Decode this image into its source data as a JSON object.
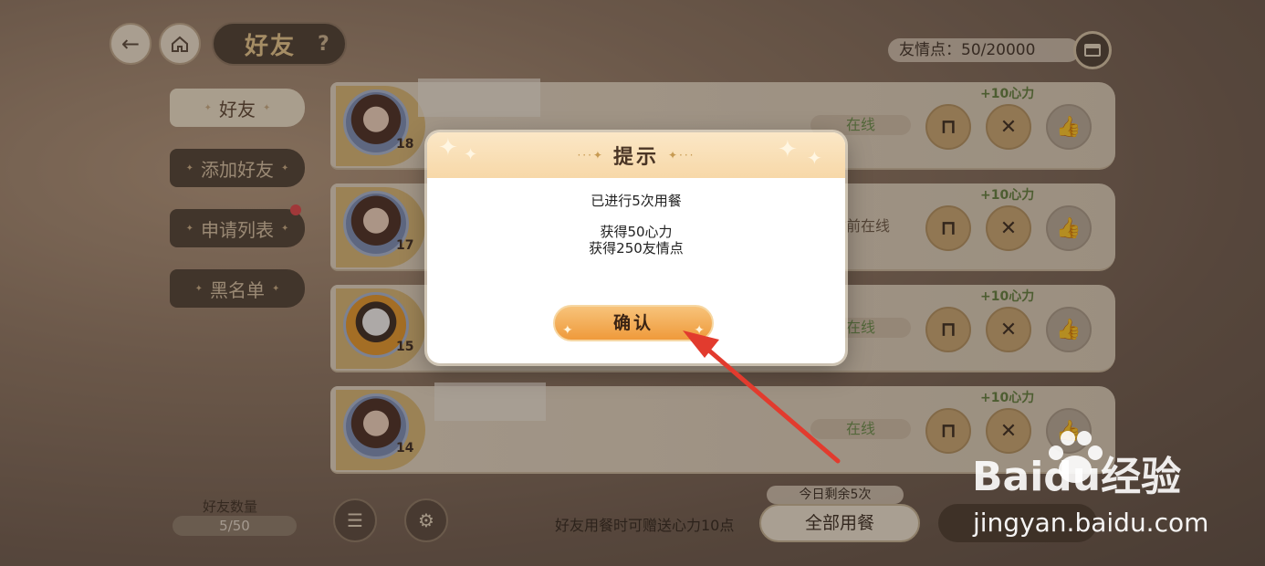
{
  "header": {
    "back_icon": "arrow-left-icon",
    "home_icon": "home-icon",
    "title": "好友",
    "help_label": "?",
    "points_label": "友情点：50/20000",
    "shop_icon": "shop-icon"
  },
  "tabs": [
    {
      "label": "好友",
      "active": true
    },
    {
      "label": "添加好友",
      "active": false
    },
    {
      "label": "申请列表",
      "active": false,
      "has_badge": true
    },
    {
      "label": "黑名单",
      "active": false
    }
  ],
  "friends": [
    {
      "level": "18",
      "status": "在线",
      "bonus": "+10心力"
    },
    {
      "level": "17",
      "status": "时前在线",
      "bonus": "+10心力"
    },
    {
      "level": "15",
      "status": "在线",
      "bonus": "+10心力"
    },
    {
      "level": "14",
      "status": "在线",
      "bonus": "+10心力"
    }
  ],
  "footer": {
    "count_label": "好友数量",
    "count_value": "5/50",
    "sort_icon": "sort-icon",
    "settings_icon": "user-settings-icon",
    "hint": "好友用餐时可赠送心力10点",
    "remain": "今日剩余5次",
    "all_dine_label": "全部用餐"
  },
  "modal": {
    "title": "提示",
    "line1": "已进行5次用餐",
    "line2": "获得50心力",
    "line3": "获得250友情点",
    "confirm_label": "确认"
  },
  "watermark": {
    "logo": "Baidu经验",
    "url": "jingyan.baidu.com"
  },
  "colors": {
    "modal_button": "#ef9a3b",
    "online_text": "#6b8f4d",
    "arrow": "#e23b2e"
  }
}
